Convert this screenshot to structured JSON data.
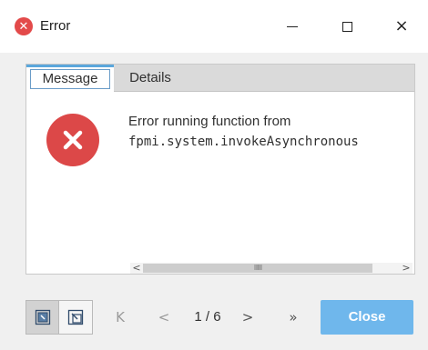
{
  "window": {
    "title": "Error",
    "title_icon": "error-circle-icon",
    "controls": {
      "minimize": "minimize-icon",
      "maximize": "maximize-icon",
      "close": "×"
    }
  },
  "tabs": [
    {
      "label": "Message",
      "selected": true
    },
    {
      "label": "Details",
      "selected": false
    }
  ],
  "message": {
    "icon": "error-x-icon",
    "line1": "Error running function from",
    "line2": "fpmi.system.invokeAsynchronous"
  },
  "scrollbar": {
    "left_arrow": "<",
    "right_arrow": ">",
    "grip": "IIIIIII"
  },
  "footer": {
    "nav_first": "K",
    "nav_prev": "<",
    "counter": "1 / 6",
    "nav_next": ">",
    "nav_last": "»",
    "close_label": "Close"
  },
  "colors": {
    "error_red": "#dc4848",
    "accent_blue": "#6fb7ec",
    "tab_highlight": "#5aa7dc"
  }
}
